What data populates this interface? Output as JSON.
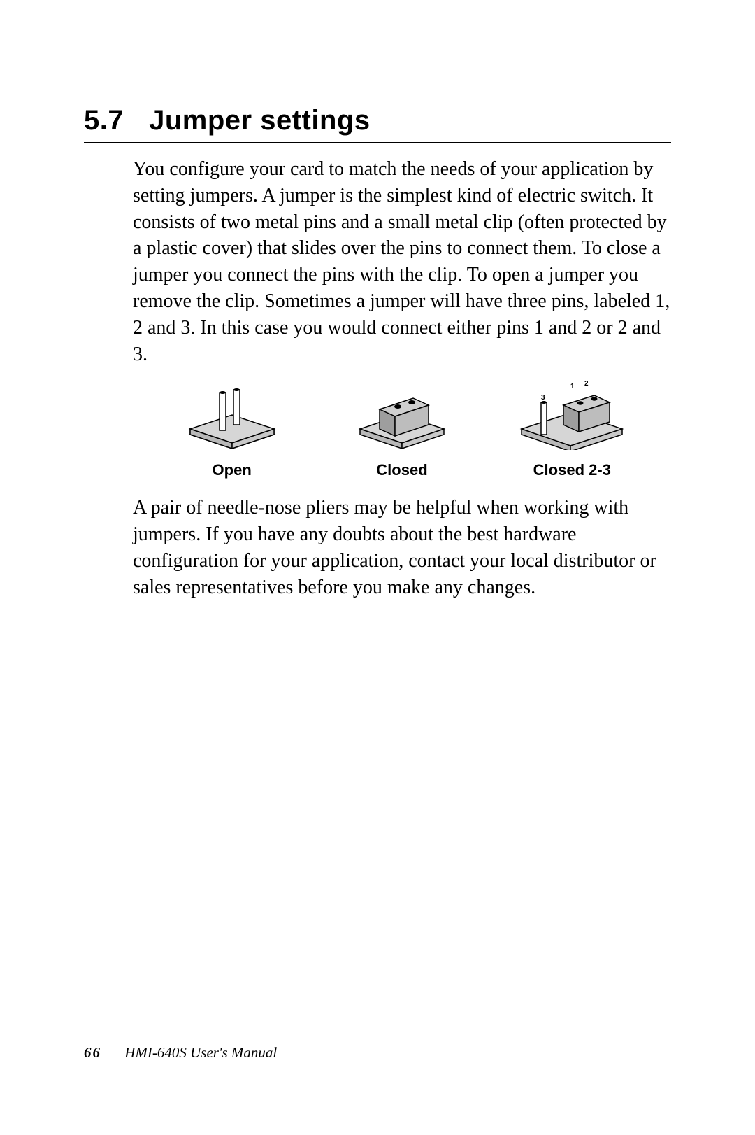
{
  "heading": {
    "number": "5.7",
    "title": "Jumper settings"
  },
  "paragraphs": {
    "p1": "You configure your card to match the needs of your application by setting jumpers. A jumper is the simplest kind of electric switch. It consists of two metal pins and a small metal clip (often protected by a plastic cover) that slides over the pins to connect them. To close a jumper you connect the pins with the clip. To open a jumper you remove the clip. Sometimes a jumper will have three pins, labeled 1, 2 and 3. In this case you would connect either pins 1 and 2 or 2 and 3.",
    "p2": "A pair of needle-nose pliers may be helpful when working with jumpers. If you have any doubts about the best hardware configuration for your application, contact your local distributor or sales representatives before you make any changes."
  },
  "figures": {
    "open": "Open",
    "closed": "Closed",
    "closed23": "Closed 2-3",
    "pin_labels": {
      "one": "1",
      "two": "2",
      "three": "3"
    }
  },
  "footer": {
    "page": "66",
    "doc": "HMI-640S  User's Manual"
  }
}
